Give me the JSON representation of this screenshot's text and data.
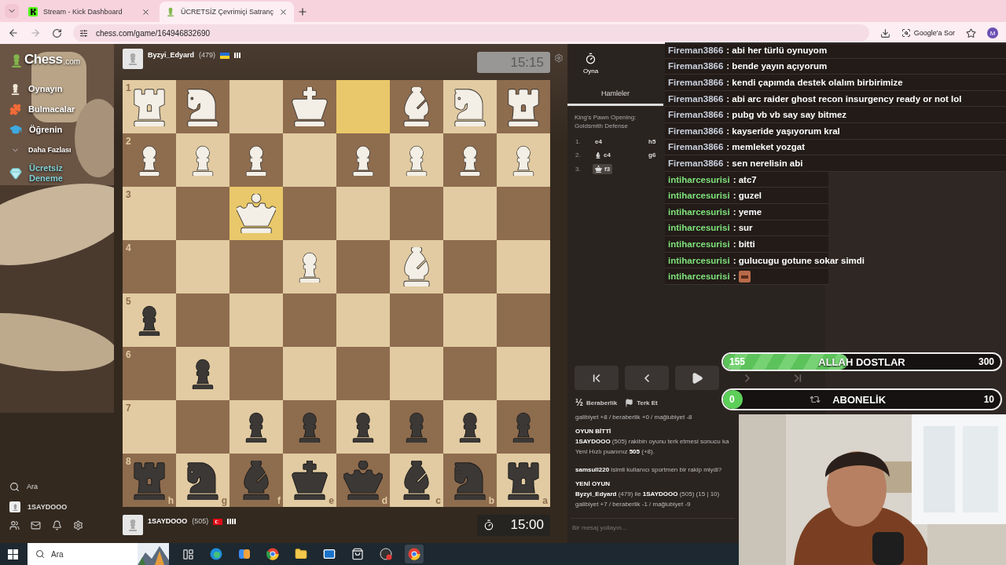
{
  "browser": {
    "tabs": [
      {
        "title": "Stream - Kick Dashboard",
        "selected": false,
        "kind": "kick"
      },
      {
        "title": "ÜCRETSİZ Çevrimiçi Satranç",
        "selected": true,
        "kind": "chess"
      }
    ],
    "url": "chess.com/game/164946832690",
    "ask_button": "Google'a Sor",
    "profile_initial": "M"
  },
  "sidebar": {
    "logo": "Chess",
    "logo_suffix": ".com",
    "items": [
      {
        "label": "Oynayın",
        "kind": "play"
      },
      {
        "label": "Bulmacalar",
        "kind": "puzzles"
      },
      {
        "label": "Öğrenin",
        "kind": "learn"
      },
      {
        "label": "Daha Fazlası",
        "kind": "more"
      },
      {
        "label": "Ücretsiz Deneme",
        "kind": "promo"
      }
    ],
    "search": "Ara",
    "user": "1SAYDOOO"
  },
  "game": {
    "top_player": {
      "name": "Byzyi_Edyard",
      "rating": "(479)",
      "flag": {
        "kind": "ukraine"
      },
      "clock": "15:15",
      "clock_active": false
    },
    "bottom_player": {
      "name": "1SAYDOOO",
      "rating": "(505)",
      "flag": {
        "kind": "turkey"
      },
      "clock": "15:00",
      "clock_active": true
    },
    "board": {
      "files": [
        "h",
        "g",
        "f",
        "e",
        "d",
        "c",
        "b",
        "a"
      ],
      "rows": [
        {
          "rank": "1",
          "squares": [
            {
              "kind": "rook",
              "white": true,
              "highlighted": false
            },
            {
              "kind": "knight",
              "white": true,
              "highlighted": false
            },
            {
              "kind": "empty",
              "highlighted": false
            },
            {
              "kind": "king",
              "white": true,
              "highlighted": false
            },
            {
              "kind": "empty",
              "highlighted": true
            },
            {
              "kind": "bishop",
              "white": true,
              "highlighted": false
            },
            {
              "kind": "knight",
              "white": true,
              "highlighted": false
            },
            {
              "kind": "rook",
              "white": true,
              "highlighted": false
            }
          ]
        },
        {
          "rank": "2",
          "squares": [
            {
              "kind": "pawn",
              "white": true,
              "highlighted": false
            },
            {
              "kind": "pawn",
              "white": true,
              "highlighted": false
            },
            {
              "kind": "pawn",
              "white": true,
              "highlighted": false
            },
            {
              "kind": "empty",
              "highlighted": false
            },
            {
              "kind": "pawn",
              "white": true,
              "highlighted": false
            },
            {
              "kind": "pawn",
              "white": true,
              "highlighted": false
            },
            {
              "kind": "pawn",
              "white": true,
              "highlighted": false
            },
            {
              "kind": "pawn",
              "white": true,
              "highlighted": false
            }
          ]
        },
        {
          "rank": "3",
          "squares": [
            {
              "kind": "empty",
              "highlighted": false
            },
            {
              "kind": "empty",
              "highlighted": false
            },
            {
              "kind": "queen",
              "white": true,
              "highlighted": true
            },
            {
              "kind": "empty",
              "highlighted": false
            },
            {
              "kind": "empty",
              "highlighted": false
            },
            {
              "kind": "empty",
              "highlighted": false
            },
            {
              "kind": "empty",
              "highlighted": false
            },
            {
              "kind": "empty",
              "highlighted": false
            }
          ]
        },
        {
          "rank": "4",
          "squares": [
            {
              "kind": "empty",
              "highlighted": false
            },
            {
              "kind": "empty",
              "highlighted": false
            },
            {
              "kind": "empty",
              "highlighted": false
            },
            {
              "kind": "pawn",
              "white": true,
              "highlighted": false
            },
            {
              "kind": "empty",
              "highlighted": false
            },
            {
              "kind": "bishop",
              "white": true,
              "highlighted": false
            },
            {
              "kind": "empty",
              "highlighted": false
            },
            {
              "kind": "empty",
              "highlighted": false
            }
          ]
        },
        {
          "rank": "5",
          "squares": [
            {
              "kind": "pawn",
              "white": false,
              "highlighted": false
            },
            {
              "kind": "empty",
              "highlighted": false
            },
            {
              "kind": "empty",
              "highlighted": false
            },
            {
              "kind": "empty",
              "highlighted": false
            },
            {
              "kind": "empty",
              "highlighted": false
            },
            {
              "kind": "empty",
              "highlighted": false
            },
            {
              "kind": "empty",
              "highlighted": false
            },
            {
              "kind": "empty",
              "highlighted": false
            }
          ]
        },
        {
          "rank": "6",
          "squares": [
            {
              "kind": "empty",
              "highlighted": false
            },
            {
              "kind": "pawn",
              "white": false,
              "highlighted": false
            },
            {
              "kind": "empty",
              "highlighted": false
            },
            {
              "kind": "empty",
              "highlighted": false
            },
            {
              "kind": "empty",
              "highlighted": false
            },
            {
              "kind": "empty",
              "highlighted": false
            },
            {
              "kind": "empty",
              "highlighted": false
            },
            {
              "kind": "empty",
              "highlighted": false
            }
          ]
        },
        {
          "rank": "7",
          "squares": [
            {
              "kind": "empty",
              "highlighted": false
            },
            {
              "kind": "empty",
              "highlighted": false
            },
            {
              "kind": "pawn",
              "white": false,
              "highlighted": false
            },
            {
              "kind": "pawn",
              "white": false,
              "highlighted": false
            },
            {
              "kind": "pawn",
              "white": false,
              "highlighted": false
            },
            {
              "kind": "pawn",
              "white": false,
              "highlighted": false
            },
            {
              "kind": "pawn",
              "white": false,
              "highlighted": false
            },
            {
              "kind": "pawn",
              "white": false,
              "highlighted": false
            }
          ]
        },
        {
          "rank": "8",
          "squares": [
            {
              "kind": "rook",
              "white": false,
              "highlighted": false
            },
            {
              "kind": "knight",
              "white": false,
              "highlighted": false
            },
            {
              "kind": "bishop",
              "white": false,
              "highlighted": false
            },
            {
              "kind": "king",
              "white": false,
              "highlighted": false
            },
            {
              "kind": "queen",
              "white": false,
              "highlighted": false
            },
            {
              "kind": "bishop",
              "white": false,
              "highlighted": false
            },
            {
              "kind": "knight",
              "white": false,
              "highlighted": false
            },
            {
              "kind": "rook",
              "white": false,
              "highlighted": false
            }
          ]
        }
      ]
    }
  },
  "panel": {
    "tabs": [
      {
        "label": "Oyna",
        "selected": true
      }
    ],
    "subtabs": [
      {
        "label": "Hamleler",
        "selected": true
      }
    ],
    "opening": "King's Pawn Opening: Goldsmith Defense",
    "moves": [
      {
        "number": "1.",
        "white": "e4",
        "kind": "plain",
        "black": "h5",
        "selected": false
      },
      {
        "number": "2.",
        "white": "c4",
        "kind": "bishop",
        "black": "g6",
        "selected": false
      },
      {
        "number": "3.",
        "white": "f3",
        "kind": "queen",
        "selected": true
      }
    ],
    "nav": [
      {
        "kind": "first",
        "disabled": false
      },
      {
        "kind": "previous",
        "disabled": false
      },
      {
        "kind": "play",
        "disabled": false
      },
      {
        "kind": "next",
        "disabled": true
      },
      {
        "kind": "last",
        "disabled": true
      }
    ],
    "actions": [
      {
        "label": "Beraberlik",
        "kind": "draw",
        "icon_text": "½"
      },
      {
        "label": "Terk Et",
        "kind": "resign"
      }
    ],
    "messages": [
      {
        "kind": "line",
        "text": "galibiyet +8 / beraberlik +0 / mağlubiyet -8"
      },
      {
        "kind": "heading",
        "text": "OYUN BİTTİ"
      },
      {
        "kind": "line",
        "text": "**1SAYDOOO** (505) rakibin oyunu terk etmesi sonucu ka"
      },
      {
        "kind": "line",
        "text": "Yeni Hızlı puanınız **505** (+8)."
      },
      {
        "kind": "note",
        "text": "**samsull220** isimli kullanıcı sportmen bir rakip miydi?"
      },
      {
        "kind": "heading",
        "text": "YENİ OYUN"
      },
      {
        "kind": "line",
        "text": "**Byzyi_Edyard** (479) ile **1SAYDOOO** (505) (15 | 10)"
      },
      {
        "kind": "line",
        "text": "galibiyet +7 / beraberlik -1 / mağlubiyet -9"
      }
    ],
    "chat_placeholder": "Bir mesaj yollayın..."
  },
  "stream_chat": [
    {
      "user": "Fireman3866",
      "text": ": abi her türlü oynuyom",
      "color": "#c8cfdc"
    },
    {
      "user": "Fireman3866",
      "text": ": bende yayın açıyorum",
      "color": "#c8cfdc"
    },
    {
      "user": "Fireman3866",
      "text": ": kendi çapımda destek olalım birbirimize",
      "color": "#c8cfdc"
    },
    {
      "user": "Fireman3866",
      "text": ": abi arc raider ghost recon insurgency ready or not lol",
      "color": "#c8cfdc"
    },
    {
      "user": "Fireman3866",
      "text": ": pubg vb vb say say bitmez",
      "color": "#c8cfdc"
    },
    {
      "user": "Fireman3866",
      "text": ": kayseride yaşıyorum kral",
      "color": "#c8cfdc"
    },
    {
      "user": "Fireman3866",
      "text": ": memleket yozgat",
      "color": "#c8cfdc"
    },
    {
      "user": "Fireman3866",
      "text": ": sen nerelisin abi",
      "color": "#c8cfdc"
    },
    {
      "user": "intiharcesurisi",
      "text": ": atc7",
      "color": "#7ee07a"
    },
    {
      "user": "intiharcesurisi",
      "text": ": guzel",
      "color": "#7ee07a"
    },
    {
      "user": "intiharcesurisi",
      "text": ": yeme",
      "color": "#7ee07a"
    },
    {
      "user": "intiharcesurisi",
      "text": ": sur",
      "color": "#7ee07a"
    },
    {
      "user": "intiharcesurisi",
      "text": ": bitti",
      "color": "#7ee07a"
    },
    {
      "user": "intiharcesurisi",
      "text": ": gulucugu gotune sokar simdi",
      "color": "#7ee07a"
    },
    {
      "user": "intiharcesurisi",
      "text": ":",
      "color": "#7ee07a",
      "emote": true
    }
  ],
  "goals": [
    {
      "label": "ALLAH DOSTLAR",
      "current": "155",
      "target": "300",
      "level": 0.45,
      "kind": "striped"
    },
    {
      "label": "ABONELİK",
      "current": "0",
      "target": "10",
      "level": 0,
      "kind": "recurring"
    }
  ],
  "taskbar": {
    "search": "Ara"
  }
}
